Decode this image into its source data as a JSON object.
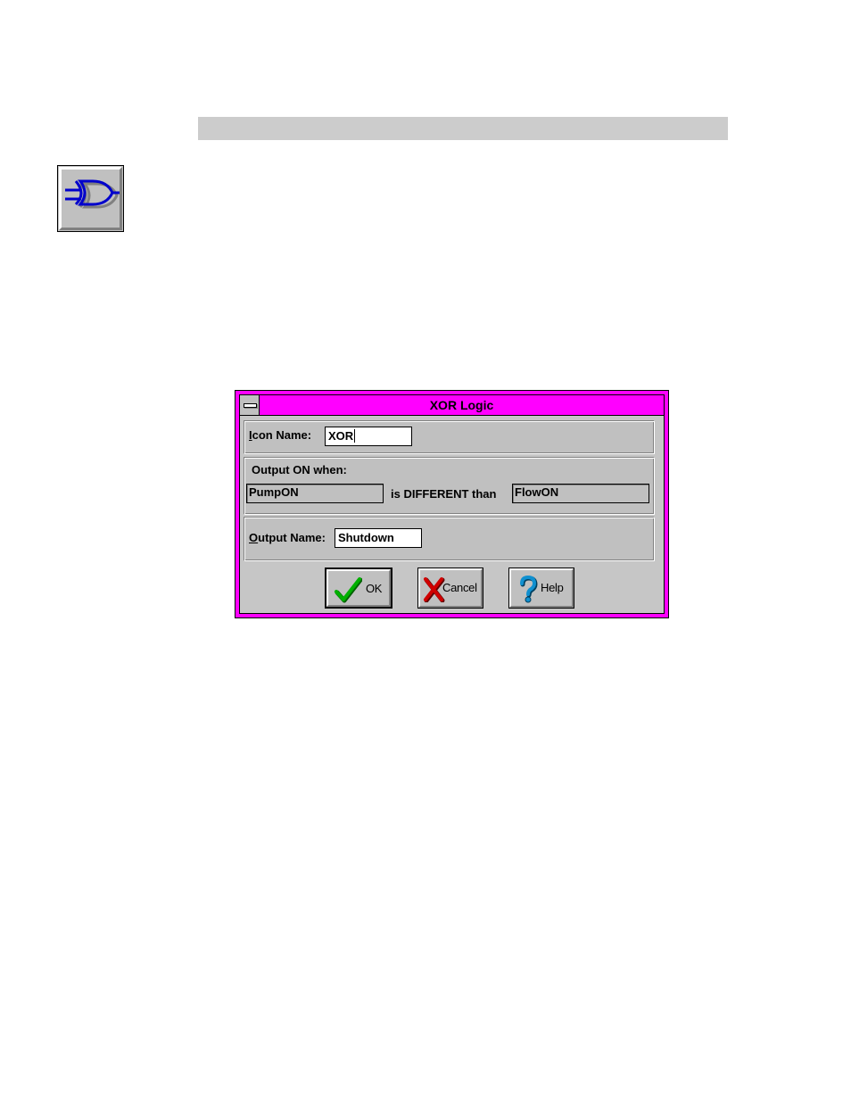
{
  "dialog": {
    "title": "XOR Logic",
    "icon_name": {
      "label_mnemonic": "I",
      "label_rest": "con Name:",
      "value": "XOR"
    },
    "output_on": {
      "heading": "Output ON when:",
      "input_a": "PumpON",
      "relation": "is DIFFERENT than",
      "input_b": "FlowON"
    },
    "output_name": {
      "label_mnemonic": "O",
      "label_rest": "utput Name:",
      "value": "Shutdown"
    },
    "buttons": {
      "ok": "OK",
      "cancel": "Cancel",
      "help": "Help"
    }
  },
  "colors": {
    "dialog_frame": "#ff00ff",
    "face": "#c0c0c0",
    "header_bar": "#cccccc",
    "gate_icon": "#0000cc",
    "ok_check": "#00a000",
    "cancel_x": "#cc0000",
    "help_question": "#0080c0"
  },
  "icons": {
    "tool_button": "xor-gate-icon",
    "system_menu": "system-menu-icon",
    "ok": "check-icon",
    "cancel": "x-icon",
    "help": "question-icon"
  }
}
